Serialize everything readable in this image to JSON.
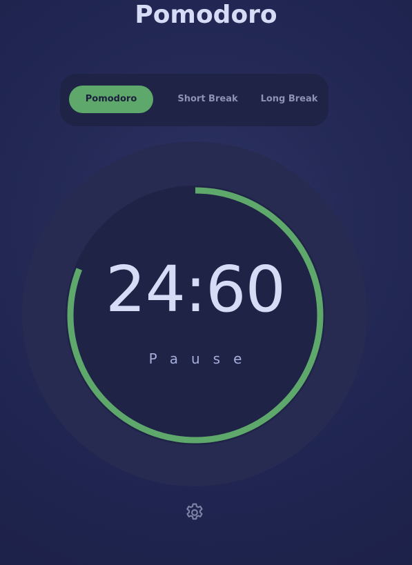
{
  "app": {
    "title": "Pomodoro"
  },
  "modes": {
    "tabs": [
      {
        "label": "Pomodoro",
        "active": true
      },
      {
        "label": "Short Break",
        "active": false
      },
      {
        "label": "Long Break",
        "active": false
      }
    ]
  },
  "timer": {
    "time": "24:60",
    "action_label": "Pause",
    "progress": 0.81
  },
  "settings": {
    "icon": "gear-icon"
  },
  "colors": {
    "accent": "#5ea86c",
    "background": "#1f2450",
    "text": "#d6dbf6",
    "muted": "#8c93b4"
  }
}
